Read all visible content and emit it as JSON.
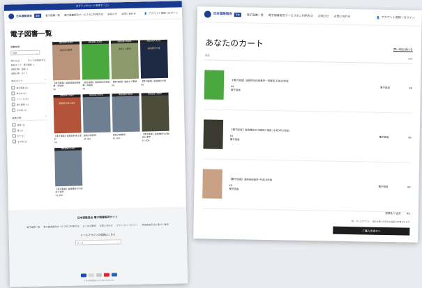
{
  "left_page": {
    "announcement": "ログインやカード決済で「ご」",
    "logo": {
      "org": "日本道路協会",
      "badge": "図書"
    },
    "nav": [
      "電子図書一覧",
      "電子図書販売サービスのご利用方法",
      "お知らせ",
      "お問い合わせ"
    ],
    "account": "アカウント登録 / ログイン",
    "page_title": "電子図書一覧",
    "sidebar": {
      "search_label": "図書検索",
      "search_placeholder": "検索",
      "filter_label": "絞り込み",
      "clear_label": "すべてを削除する",
      "chips": [
        "商品タイプ：電子図書 ×",
        "道路分類：道路 ×",
        "道路分類：ICT ×"
      ],
      "group1_title": "商品タイプ",
      "group1_options": [
        "電子図書 (9)",
        "単行本 (5)",
        "シリーズ (3)",
        "電子図書 (1)",
        "その他 (1)"
      ],
      "group2_title": "道路分類",
      "group2_options": [
        "道路 (5)",
        "橋 (2)",
        "ICT (1)",
        "その他 (1)"
      ]
    },
    "products": [
      {
        "tag": "道路会議大賞受賞",
        "title": "道路技術基準",
        "name": "【電子図書】道路標識設置基準・同解説",
        "price": "¥0"
      },
      {
        "tag": "道路会議大賞受賞",
        "title": "",
        "name": "【電子図書】道路緑化技術基準・同解説",
        "price": "¥0"
      },
      {
        "tag": "道路会議大賞受賞",
        "title": "道路土工要綱",
        "name": "【電子図書】道路土工要綱",
        "price": "¥0"
      },
      {
        "tag": "道路会議大賞受賞",
        "title": "道路橋示方書",
        "name": "【電子図書】道路橋示方書",
        "price": "¥0"
      },
      {
        "tag": "道路会議大賞受賞",
        "title": "舗装設計施工指針",
        "name": "【電子図書】舗装設計施工指針",
        "price": "¥0"
      },
      {
        "tag": "道路会議大賞受賞",
        "title": "",
        "name": "舗装点検要領",
        "price": "¥1,000"
      },
      {
        "tag": "道路会議大賞受賞",
        "title": "",
        "name": "舗装点検要領",
        "price": "¥1,000"
      },
      {
        "tag": "道路会議大賞受賞",
        "title": "",
        "name": "【電子図書】道路構造令の解説と運用",
        "price": "¥1,000"
      },
      {
        "tag": "道路会議大賞受賞",
        "title": "",
        "name": "【電子図書】道路構造令の解説と運用",
        "price": "¥1,000"
      }
    ],
    "footer": {
      "title": "日本道路協会 電子図書販売サイト",
      "links": [
        "電子図書一覧",
        "電子図書販売サービスのご利用方法",
        "よくある質問",
        "お問い合わせ",
        "プライバシーポリシー",
        "特定商取引法に基づく表記"
      ],
      "mailmag": "メールマガジンの登録はこちら",
      "select_value": "メール",
      "copyright": "© 日本道路協会 All rights reserved."
    }
  },
  "right_page": {
    "logo": {
      "org": "日本道路協会",
      "badge": "図書"
    },
    "nav": [
      "電子図書一覧",
      "電子図書販売サービスのご利用方法",
      "お知らせ",
      "お問い合わせ"
    ],
    "account": "アカウント登録 / ログイン",
    "cart_title": "あなたのカート",
    "continue_link": "買い物を続ける",
    "col_item": "商品",
    "col_qty": "数量",
    "col_amount": "合計",
    "items": [
      {
        "name": "【電子図書】道路緑化技術基準・同解説 平成28年版",
        "price": "¥0",
        "type": "電子図書",
        "qty": "電子図書",
        "amount": "¥0"
      },
      {
        "name": "【電子図書】道路構造令の解説と運用 (令和3年3月版)",
        "price": "¥0",
        "type": "電子図書",
        "qty": "電子図書",
        "amount": "¥0"
      },
      {
        "name": "【電子図書】道路技術基準 平成19年版",
        "price": "¥0",
        "type": "電子図書",
        "qty": "電子図書",
        "amount": "¥0"
      }
    ],
    "total_label": "見積もり合計",
    "total_value": "¥0",
    "note": "税、ディスカウント、送料は購入手続きの画面で計算されます",
    "checkout": "ご購入手続きへ"
  },
  "colors": {
    "brand": "#1f3f8f",
    "announcement_bar": "#173a8e",
    "cover_brown": "#b9947a",
    "cover_green": "#4aa93e",
    "cover_sage": "#8a9a6b",
    "cover_navy": "#1e2a44",
    "cover_rust": "#b4533a",
    "cover_slate": "#6f7f92",
    "cover_olive": "#4b4d3a"
  }
}
